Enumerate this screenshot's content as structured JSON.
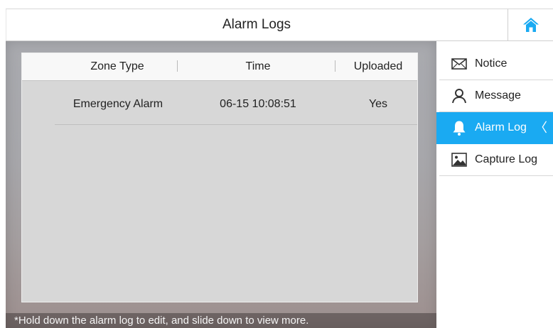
{
  "header": {
    "title": "Alarm Logs",
    "home_icon": "home-icon"
  },
  "table": {
    "columns": [
      "Zone Type",
      "Time",
      "Uploaded"
    ],
    "rows": [
      {
        "zone_type": "Emergency Alarm",
        "time": "06-15 10:08:51",
        "uploaded": "Yes"
      }
    ]
  },
  "hint": "*Hold down the alarm log to edit, and slide down to view more.",
  "sidebar": {
    "items": [
      {
        "label": "Notice",
        "icon": "envelope-icon",
        "active": false
      },
      {
        "label": "Message",
        "icon": "person-icon",
        "active": false
      },
      {
        "label": "Alarm Log",
        "icon": "bell-icon",
        "active": true
      },
      {
        "label": "Capture Log",
        "icon": "image-icon",
        "active": false
      }
    ]
  },
  "colors": {
    "accent": "#1aaaf2",
    "home_icon": "#1aaaf2"
  }
}
